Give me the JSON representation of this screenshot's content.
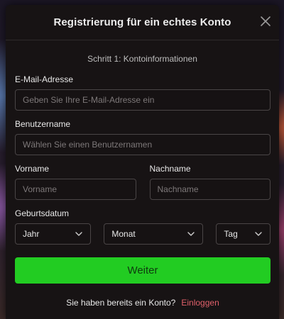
{
  "modal": {
    "title": "Registrierung für ein echtes Konto",
    "close_icon": "close-icon",
    "step": "Schritt 1: Kontoinformationen"
  },
  "form": {
    "email": {
      "label": "E-Mail-Adresse",
      "placeholder": "Geben Sie Ihre E-Mail-Adresse ein",
      "value": ""
    },
    "username": {
      "label": "Benutzername",
      "placeholder": "Wählen Sie einen Benutzernamen",
      "value": ""
    },
    "firstname": {
      "label": "Vorname",
      "placeholder": "Vorname",
      "value": ""
    },
    "lastname": {
      "label": "Nachname",
      "placeholder": "Nachname",
      "value": ""
    },
    "birthdate": {
      "label": "Geburtsdatum",
      "year": "Jahr",
      "month": "Monat",
      "day": "Tag"
    },
    "submit_label": "Weiter"
  },
  "footer": {
    "text": "Sie haben bereits ein Konto?",
    "login_link": "Einloggen"
  },
  "colors": {
    "accent": "#22cc22",
    "link": "#e0606a",
    "modal_bg": "#171314"
  }
}
